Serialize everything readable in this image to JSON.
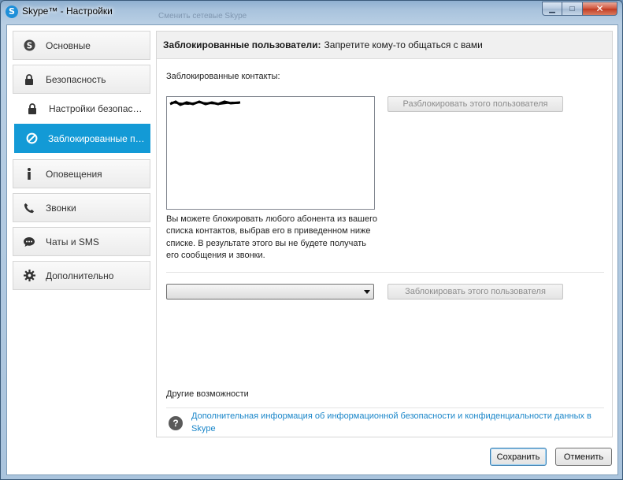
{
  "window": {
    "title": "Skype™ - Настройки",
    "icon_letter": "S",
    "ghost_text": "Сменить сетевые Skype",
    "min_glyph": "▁",
    "max_glyph": "□",
    "close_glyph": "✕"
  },
  "sidebar": {
    "items": [
      {
        "label": "Основные",
        "icon": "skype-icon"
      },
      {
        "label": "Безопасность",
        "icon": "lock-icon"
      },
      {
        "label": "Настройки безопасности",
        "icon": "lock-icon"
      },
      {
        "label": "Заблокированные пользователи",
        "icon": "block-icon"
      },
      {
        "label": "Оповещения",
        "icon": "info-icon"
      },
      {
        "label": "Звонки",
        "icon": "phone-icon"
      },
      {
        "label": "Чаты и SMS",
        "icon": "chat-icon"
      },
      {
        "label": "Дополнительно",
        "icon": "gear-icon"
      }
    ],
    "active_index": 3
  },
  "main": {
    "header_bold": "Заблокированные пользователи:",
    "header_text": "Запретите кому-то общаться с вами",
    "blocked_label": "Заблокированные контакты:",
    "unblock_button": "Разблокировать этого пользователя",
    "description": "Вы можете блокировать любого абонента из вашего списка контактов, выбрав его в приведенном ниже списке. В результате этого вы не будете получать его сообщения и звонки.",
    "select_value": "",
    "block_button": "Заблокировать этого пользователя",
    "other_label": "Другие возможности",
    "help_glyph": "?",
    "link_text": "Дополнительная информация об информационной безопасности и конфиденциальности данных в Skype"
  },
  "footer": {
    "save_label": "Сохранить",
    "cancel_label": "Отменить"
  },
  "colors": {
    "accent": "#139ad6",
    "link": "#1a86c9"
  }
}
